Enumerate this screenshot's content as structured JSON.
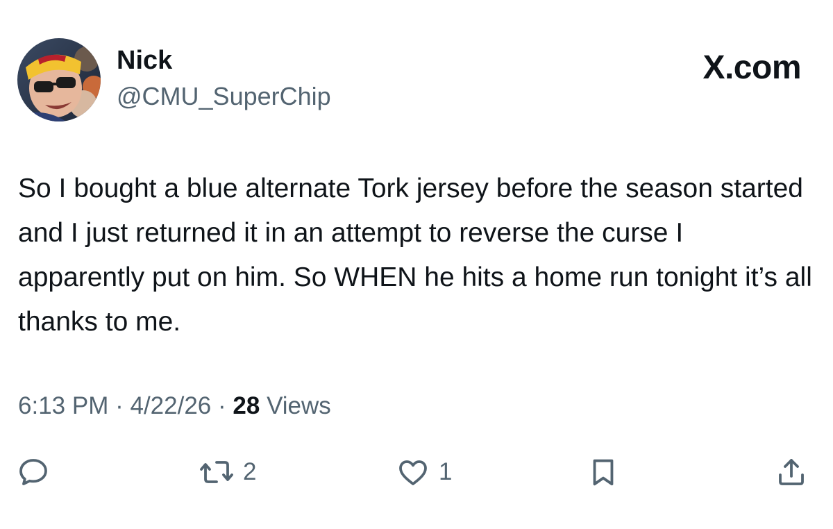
{
  "author": {
    "display_name": "Nick",
    "handle": "@CMU_SuperChip"
  },
  "brand": {
    "label": "X.com"
  },
  "tweet": {
    "text": "So I bought a blue alternate Tork jersey before the season started and I just returned it in an attempt to reverse the curse I apparently put on him. So WHEN he hits a home run tonight it’s all thanks to me."
  },
  "meta": {
    "time": "6:13 PM",
    "separator": "·",
    "date": "4/22/26",
    "views_count": "28",
    "views_label": "Views"
  },
  "actions": {
    "reply": {
      "icon": "reply-icon"
    },
    "repost": {
      "icon": "repost-icon",
      "count": "2"
    },
    "like": {
      "icon": "heart-icon",
      "count": "1"
    },
    "bookmark": {
      "icon": "bookmark-icon"
    },
    "share": {
      "icon": "share-icon"
    }
  },
  "colors": {
    "text_primary": "#0f1419",
    "text_secondary": "#536471",
    "background": "#ffffff"
  }
}
